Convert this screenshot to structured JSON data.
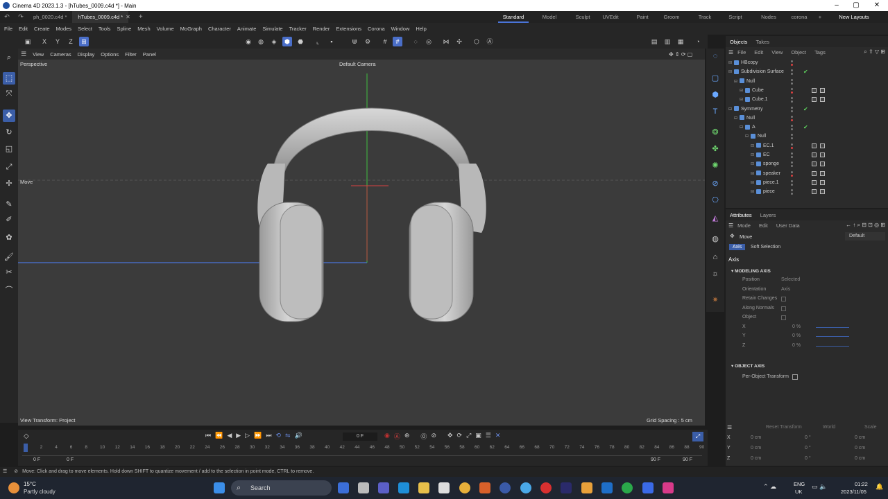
{
  "app": {
    "title": "Cinema 4D 2023.1.3 - [hTubes_0009.c4d *] - Main",
    "minimize": "–",
    "maximize": "▢",
    "close": "✕"
  },
  "tabs": {
    "documents": [
      {
        "label": "ph_0020.c4d *",
        "active": false
      },
      {
        "label": "hTubes_0009.c4d *",
        "active": true
      }
    ],
    "close_tab": "✕",
    "add_tab": "+",
    "layouts": [
      "Standard",
      "Model",
      "Sculpt",
      "UVEdit",
      "Paint",
      "Groom",
      "Track",
      "Script",
      "Nodes",
      "corona"
    ],
    "active_layout": "Standard",
    "add_layout": "+",
    "new_layouts": "New Layouts"
  },
  "menus": [
    "File",
    "Edit",
    "Create",
    "Modes",
    "Select",
    "Tools",
    "Spline",
    "Mesh",
    "Volume",
    "MoGraph",
    "Character",
    "Animate",
    "Simulate",
    "Tracker",
    "Render",
    "Extensions",
    "Corona",
    "Window",
    "Help"
  ],
  "toolbar": {
    "x": "X",
    "y": "Y",
    "z": "Z"
  },
  "viewport": {
    "menu": [
      "View",
      "Cameras",
      "Display",
      "Options",
      "Filter",
      "Panel"
    ],
    "name": "Perspective",
    "camera": "Default Camera",
    "tool_label": "Move",
    "view_transform": "View Transform: Project",
    "grid_spacing": "Grid Spacing : 5 cm"
  },
  "objects_panel": {
    "tabs": [
      "Objects",
      "Takes"
    ],
    "menu": [
      "File",
      "Edit",
      "View",
      "Object",
      "Tags"
    ],
    "items": [
      {
        "name": "HBcopy",
        "depth": 0,
        "check": false,
        "tags": false
      },
      {
        "name": "Subdivision Surface",
        "depth": 0,
        "check": true,
        "tags": false
      },
      {
        "name": "Null",
        "depth": 1,
        "check": false,
        "tags": false
      },
      {
        "name": "Cube",
        "depth": 2,
        "check": false,
        "tags": true
      },
      {
        "name": "Cube.1",
        "depth": 2,
        "check": false,
        "tags": true
      },
      {
        "name": "Symmetry",
        "depth": 0,
        "check": true,
        "tags": false
      },
      {
        "name": "Null",
        "depth": 1,
        "check": false,
        "tags": false
      },
      {
        "name": "A",
        "depth": 2,
        "check": true,
        "tags": false
      },
      {
        "name": "Null",
        "depth": 3,
        "check": false,
        "tags": false
      },
      {
        "name": "EC.1",
        "depth": 4,
        "check": false,
        "tags": true
      },
      {
        "name": "EC",
        "depth": 4,
        "check": false,
        "tags": true
      },
      {
        "name": "sponge",
        "depth": 4,
        "check": false,
        "tags": true
      },
      {
        "name": "speaker",
        "depth": 4,
        "check": false,
        "tags": true
      },
      {
        "name": "piece.1",
        "depth": 4,
        "check": false,
        "tags": true
      },
      {
        "name": "piece",
        "depth": 4,
        "check": false,
        "tags": true
      }
    ]
  },
  "attributes": {
    "tabs": [
      "Attributes",
      "Layers"
    ],
    "menu": [
      "Mode",
      "Edit",
      "User Data"
    ],
    "tool": "Move",
    "preset": "Default",
    "subtabs": [
      "Axis",
      "Soft Selection"
    ],
    "section": "Axis",
    "modeling_axis": "MODELING AXIS",
    "fields": [
      {
        "label": "Position",
        "value": "Selected"
      },
      {
        "label": "Orientation",
        "value": "Axis"
      },
      {
        "label": "Retain Changes",
        "value": ""
      },
      {
        "label": "Along Normals",
        "value": ""
      },
      {
        "label": "Object",
        "value": ""
      },
      {
        "label": "X",
        "value": "0 %"
      },
      {
        "label": "Y",
        "value": "0 %"
      },
      {
        "label": "Z",
        "value": "0 %"
      }
    ],
    "object_axis": "OBJECT AXIS",
    "per_object": "Per-Object Transform"
  },
  "coordinates": {
    "reset": "Reset Transform",
    "space": "World",
    "scale": "Scale",
    "rows": [
      {
        "axis": "X",
        "pos": "0 cm",
        "rot": "0 °",
        "size": "0 cm"
      },
      {
        "axis": "Y",
        "pos": "0 cm",
        "rot": "0 °",
        "size": "0 cm"
      },
      {
        "axis": "Z",
        "pos": "0 cm",
        "rot": "0 °",
        "size": "0 cm"
      }
    ]
  },
  "timeline": {
    "current_frame": "0 F",
    "ticks": [
      "0",
      "2",
      "4",
      "6",
      "8",
      "10",
      "12",
      "14",
      "16",
      "18",
      "20",
      "22",
      "24",
      "26",
      "28",
      "30",
      "32",
      "34",
      "36",
      "38",
      "40",
      "42",
      "44",
      "46",
      "48",
      "50",
      "52",
      "54",
      "56",
      "58",
      "60",
      "62",
      "64",
      "66",
      "68",
      "70",
      "72",
      "74",
      "76",
      "78",
      "80",
      "82",
      "84",
      "86",
      "88",
      "90"
    ],
    "start": "0 F",
    "start2": "0 F",
    "end": "90 F",
    "end2": "90 F"
  },
  "status": "Move: Click and drag to move elements. Hold down SHIFT to quantize movement / add to the selection in point mode, CTRL to remove.",
  "taskbar": {
    "weather_temp": "15°C",
    "weather_desc": "Partly cloudy",
    "search": "Search",
    "lang1": "ENG",
    "lang2": "UK",
    "time": "01:22",
    "date": "2023/11/05"
  },
  "colors": {
    "accent": "#4a6ec8",
    "check": "#5ed45e",
    "viewport_bg": "#3b3b3b",
    "y_axis": "#3fbf3f",
    "x_axis": "#d94040",
    "grid_axis": "#4a74d8"
  }
}
